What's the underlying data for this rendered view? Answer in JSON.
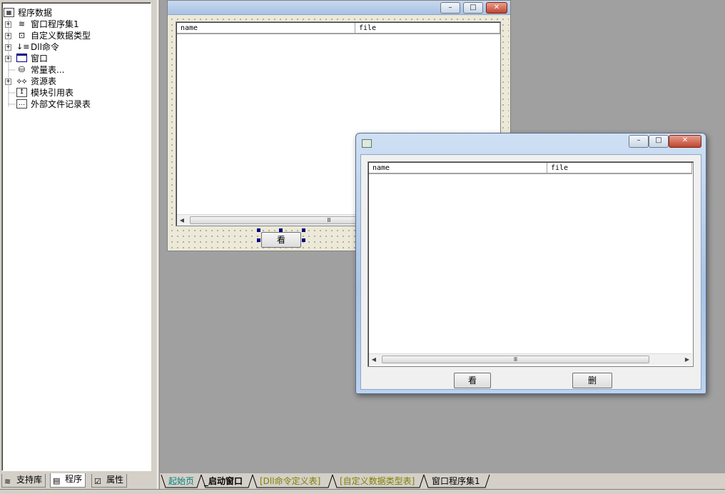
{
  "tree": {
    "root": "程序数据",
    "items": [
      {
        "label": "窗口程序集1",
        "icon": "assembly-icon",
        "expandable": true
      },
      {
        "label": "自定义数据类型",
        "icon": "datatype-icon",
        "expandable": true
      },
      {
        "label": "Dll命令",
        "icon": "dll-icon",
        "expandable": true
      },
      {
        "label": "窗口",
        "icon": "window-icon",
        "expandable": true
      },
      {
        "label": "常量表...",
        "icon": "constant-icon",
        "expandable": false
      },
      {
        "label": "资源表",
        "icon": "resource-icon",
        "expandable": true
      },
      {
        "label": "模块引用表",
        "icon": "module-icon",
        "expandable": false
      },
      {
        "label": "外部文件记录表",
        "icon": "file-record-icon",
        "expandable": false
      }
    ]
  },
  "left_tabs": [
    "支持库",
    "程序",
    "属性"
  ],
  "bottom_tabs": [
    "起始页",
    "_启动窗口",
    "[Dll命令定义表]",
    "[自定义数据类型表]",
    "窗口程序集1"
  ],
  "design_window": {
    "columns": [
      "name",
      "file"
    ],
    "button_label": "看",
    "buttons": {
      "minimize": "–",
      "restore": "□",
      "close": "✕"
    },
    "scroll_thumb": "Ⅲ"
  },
  "run_window": {
    "columns": [
      "name",
      "file"
    ],
    "view_button": "看",
    "delete_button": "删",
    "buttons": {
      "minimize": "–",
      "restore": "□",
      "close": "✕"
    },
    "scroll_thumb": "Ⅲ"
  },
  "colors": {
    "tab_start": "#008080",
    "tab_active": "#000080",
    "tab_bracket": "#808000"
  }
}
